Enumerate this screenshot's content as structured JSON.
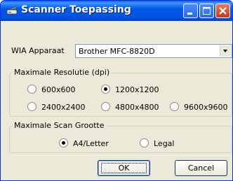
{
  "window": {
    "title": "Scanner Toepassing",
    "controls": [
      "minimize-icon",
      "maximize-icon",
      "close-icon"
    ]
  },
  "device": {
    "label": "WIA Apparaat",
    "selected": "Brother MFC-8820D"
  },
  "resolution": {
    "legend": "Maximale Resolutie (dpi)",
    "options": [
      "600x600",
      "1200x1200",
      "2400x2400",
      "4800x4800",
      "9600x9600"
    ],
    "selected": "1200x1200"
  },
  "scan_size": {
    "legend": "Maximale Scan Grootte",
    "options": [
      "A4/Letter",
      "Legal"
    ],
    "selected": "A4/Letter"
  },
  "buttons": {
    "ok": "OK",
    "cancel": "Cancel"
  },
  "colors": {
    "titlebar": "#0054e3",
    "window_bg": "#ece9d8",
    "close_button": "#c13c1d"
  }
}
